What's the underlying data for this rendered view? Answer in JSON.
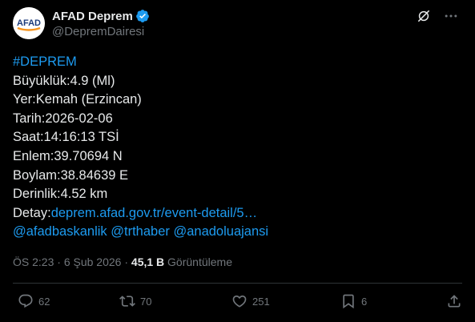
{
  "author": {
    "display_name": "AFAD Deprem",
    "handle": "@DepremDairesi",
    "avatar_text": "AFAD",
    "verified": true
  },
  "tweet": {
    "hashtag": "#DEPREM",
    "lines": [
      "Büyüklük:4.9 (Ml)",
      "Yer:Kemah (Erzincan)",
      "Tarih:2026-02-06",
      "Saat:14:16:13 TSİ",
      "Enlem:39.70694 N",
      "Boylam:38.84639 E",
      "Derinlik:4.52 km"
    ],
    "detail_label": "Detay:",
    "detail_link": "deprem.afad.gov.tr/event-detail/5…",
    "mentions": [
      "@afadbaskanlik",
      "@trthaber",
      "@anadoluajansi"
    ]
  },
  "meta": {
    "time": "ÖS 2:23",
    "separator": "·",
    "date": "6 Şub 2026",
    "views_count": "45,1 B",
    "views_label": "Görüntüleme"
  },
  "actions": {
    "replies": "62",
    "reposts": "70",
    "likes": "251",
    "bookmarks": "6"
  },
  "colors": {
    "background": "#000000",
    "text": "#e7e9ea",
    "muted": "#71767b",
    "link": "#1d9bf0",
    "divider": "#2f3336",
    "brand_orange": "#f7941d",
    "brand_blue": "#1b3a7a"
  }
}
